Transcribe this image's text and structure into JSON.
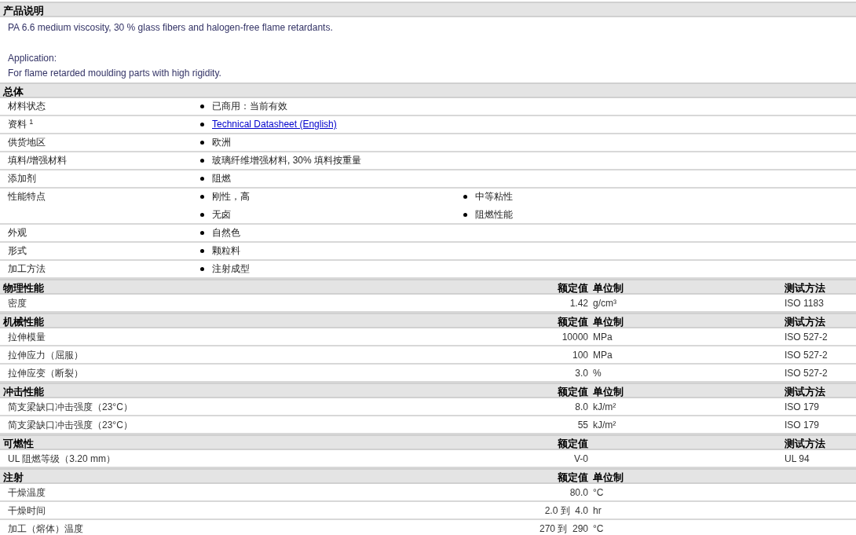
{
  "sections": [
    {
      "kind": "description",
      "title": "产品说明",
      "text": "PA 6.6 medium viscosity, 30 % glass fibers and halogen-free flame retardants.",
      "application_label": "Application:",
      "application_text": "For flame retarded moulding parts with high rigidity."
    },
    {
      "kind": "general",
      "title": "总体",
      "rows": [
        {
          "label": "材料状态",
          "items": [
            {
              "kind": "text",
              "text": "已商用：当前有效"
            }
          ]
        },
        {
          "label": "资料 $^{1}$",
          "items": [
            {
              "kind": "link",
              "text": "Technical Datasheet (English)"
            }
          ]
        },
        {
          "label": "供货地区",
          "items": [
            {
              "kind": "text",
              "text": "欧洲"
            }
          ]
        },
        {
          "label": "填料/增强材料",
          "items": [
            {
              "kind": "text",
              "text": "玻璃纤维增强材料, 30% 填料按重量"
            }
          ]
        },
        {
          "label": "添加剂",
          "items": [
            {
              "kind": "text",
              "text": "阻燃"
            }
          ]
        },
        {
          "label": "性能特点",
          "items": [
            {
              "kind": "text",
              "text": "刚性，高"
            },
            {
              "kind": "text",
              "text": "中等粘性"
            },
            {
              "kind": "text",
              "text": "无卤"
            },
            {
              "kind": "text",
              "text": "阻燃性能"
            }
          ]
        },
        {
          "label": "外观",
          "items": [
            {
              "kind": "text",
              "text": "自然色"
            }
          ]
        },
        {
          "label": "形式",
          "items": [
            {
              "kind": "text",
              "text": "颗粒料"
            }
          ]
        },
        {
          "label": "加工方法",
          "items": [
            {
              "kind": "text",
              "text": "注射成型"
            }
          ]
        }
      ]
    },
    {
      "kind": "properties",
      "title": "物理性能",
      "headers": {
        "value": "额定值",
        "unit": "单位制",
        "method": "测试方法"
      },
      "rows": [
        {
          "label": "密度",
          "value": "1.42",
          "unit": "g/cm³",
          "method": "ISO 1183"
        }
      ]
    },
    {
      "kind": "properties",
      "title": "机械性能",
      "headers": {
        "value": "额定值",
        "unit": "单位制",
        "method": "测试方法"
      },
      "rows": [
        {
          "label": "拉伸模量",
          "value": "10000",
          "unit": "MPa",
          "method": "ISO 527-2"
        },
        {
          "label": "拉伸应力（屈服）",
          "value": "100",
          "unit": "MPa",
          "method": "ISO 527-2"
        },
        {
          "label": "拉伸应变（断裂）",
          "value": "3.0",
          "unit": "%",
          "method": "ISO 527-2"
        }
      ]
    },
    {
      "kind": "properties",
      "title": "冲击性能",
      "headers": {
        "value": "额定值",
        "unit": "单位制",
        "method": "测试方法"
      },
      "rows": [
        {
          "label": "简支梁缺口冲击强度（23°C）",
          "value": "8.0",
          "unit": "kJ/m²",
          "method": "ISO 179"
        },
        {
          "label": "简支梁缺口冲击强度（23°C）",
          "value": "55",
          "unit": "kJ/m²",
          "method": "ISO 179"
        }
      ]
    },
    {
      "kind": "properties",
      "title": "可燃性",
      "headers": {
        "value": "额定值",
        "method": "测试方法"
      },
      "rows": [
        {
          "label": "UL 阻燃等级（3.20 mm）",
          "value": "V-0",
          "method": "UL 94"
        }
      ]
    },
    {
      "kind": "properties",
      "title": "注射",
      "headers": {
        "value": "额定值",
        "unit": "单位制"
      },
      "rows": [
        {
          "label": "干燥温度",
          "value": "80.0",
          "unit": "°C"
        },
        {
          "label": "干燥时间",
          "value": "2.0 到  4.0",
          "unit": "hr"
        },
        {
          "label": "加工（熔体）温度",
          "value": "270 到  290",
          "unit": "°C"
        }
      ]
    }
  ]
}
